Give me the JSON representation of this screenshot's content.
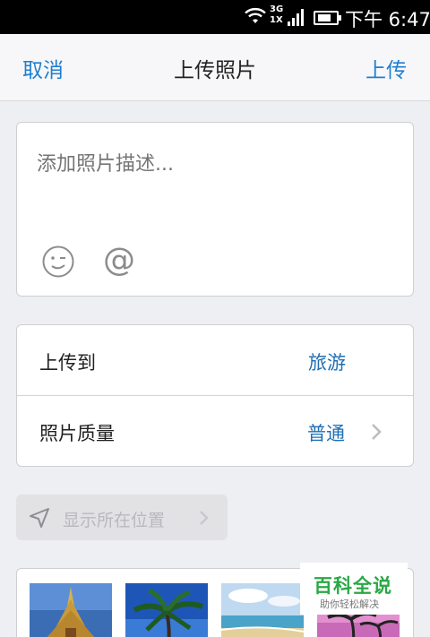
{
  "status_bar": {
    "network_top": "3G",
    "network_bottom": "1X",
    "time": "下午 6:47"
  },
  "nav": {
    "cancel_label": "取消",
    "title": "上传照片",
    "upload_label": "上传"
  },
  "description": {
    "placeholder": "添加照片描述...",
    "emoji_icon": "smiley-wink-icon",
    "mention_glyph": "@"
  },
  "settings": {
    "upload_to_label": "上传到",
    "upload_to_value": "旅游",
    "quality_label": "照片质量",
    "quality_value": "普通"
  },
  "location": {
    "label": "显示所在位置"
  },
  "photos": {
    "thumbnails": [
      "temple",
      "palm-tree-sky",
      "beach",
      "palm-sunset"
    ]
  },
  "watermark": {
    "title": "百科全说",
    "subtitle": "助你轻松解决"
  },
  "colors": {
    "accent": "#1f7fd0",
    "value_text": "#1f6fb4",
    "background": "#eeeff3",
    "watermark_green": "#2aa845"
  }
}
